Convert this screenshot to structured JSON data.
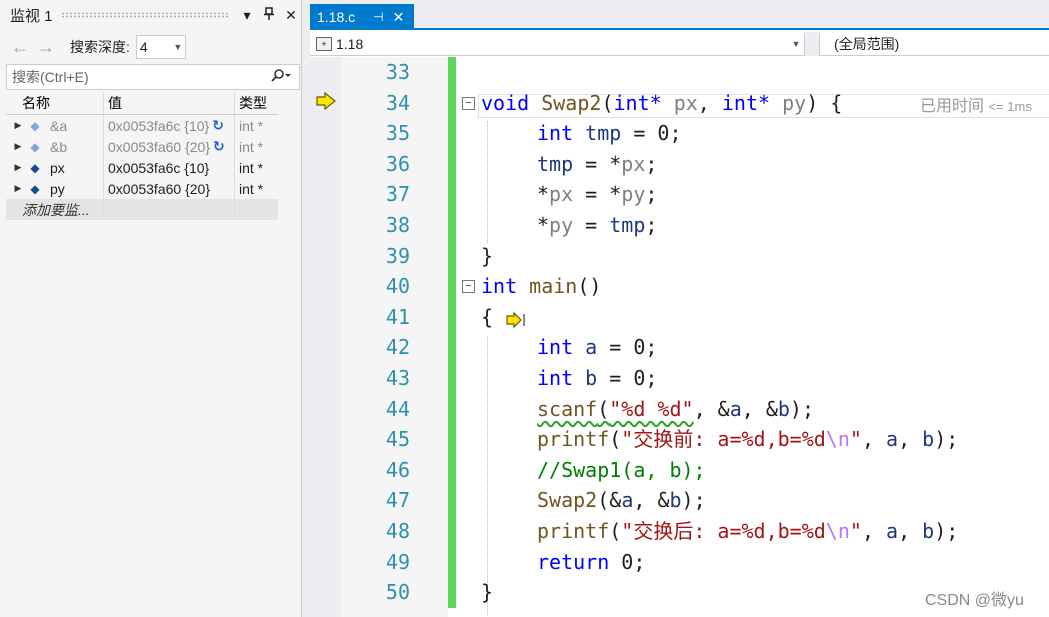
{
  "watch": {
    "title": "监视 1",
    "pin_icon": "pin-icon",
    "close_icon": "close-icon",
    "menu_icon": "dropdown-icon",
    "depth_label": "搜索深度:",
    "depth_value": "4",
    "search_placeholder": "搜索(Ctrl+E)",
    "columns": [
      "名称",
      "值",
      "类型"
    ],
    "rows": [
      {
        "name": "&a",
        "value": "0x0053fa6c {10}",
        "type": "int *",
        "stale": true
      },
      {
        "name": "&b",
        "value": "0x0053fa60 {20}",
        "type": "int *",
        "stale": true
      },
      {
        "name": "px",
        "value": "0x0053fa6c {10}",
        "type": "int *",
        "stale": false
      },
      {
        "name": "py",
        "value": "0x0053fa60 {20}",
        "type": "int *",
        "stale": false
      }
    ],
    "add_row_label": "添加要监..."
  },
  "editor": {
    "tab_label": "1.18.c",
    "nav_project": "1.18",
    "nav_scope": "(全局范围)",
    "hint_text": "已用时间",
    "hint_small": "<= 1ms",
    "line_numbers": [
      "33",
      "34",
      "35",
      "36",
      "37",
      "38",
      "39",
      "40",
      "41",
      "42",
      "43",
      "44",
      "45",
      "46",
      "47",
      "48",
      "49",
      "50"
    ],
    "code": {
      "l34": {
        "kw1": "void",
        "fn": "Swap2",
        "p1": "(",
        "kw2": "int*",
        "px": "px",
        "c": ", ",
        "kw3": "int*",
        "py": "py",
        "end": ") {"
      },
      "l35": {
        "kw": "int",
        "var": "tmp",
        "rest": " = 0;"
      },
      "l36": {
        "a": "tmp",
        "b": " = *",
        "c": "px",
        "d": ";"
      },
      "l37": {
        "a": "*",
        "b": "px",
        "c": " = *",
        "d": "py",
        "e": ";"
      },
      "l38": {
        "a": "*",
        "b": "py",
        "c": " = ",
        "d": "tmp",
        "e": ";"
      },
      "l39": "}",
      "l40": {
        "kw": "int",
        "fn": "main",
        "rest": "()"
      },
      "l41": "{",
      "l42": {
        "kw": "int",
        "var": "a",
        "rest": " = 0;"
      },
      "l43": {
        "kw": "int",
        "var": "b",
        "rest": " = 0;"
      },
      "l44": {
        "fn": "scanf",
        "p": "(",
        "str": "\"%d %d\"",
        "rest1": ", &",
        "a": "a",
        "rest2": ", &",
        "b": "b",
        "end": ");"
      },
      "l45": {
        "fn": "printf",
        "p": "(",
        "str": "\"交换前: a=%d,b=%d",
        "esc": "\\n",
        "q": "\"",
        "rest1": ", ",
        "a": "a",
        "rest2": ", ",
        "b": "b",
        "end": ");"
      },
      "l46": "//Swap1(a, b);",
      "l47": {
        "fn": "Swap2",
        "p": "(&",
        "a": "a",
        "c": ", &",
        "b": "b",
        "end": ");"
      },
      "l48": {
        "fn": "printf",
        "p": "(",
        "str": "\"交换后: a=%d,b=%d",
        "esc": "\\n",
        "q": "\"",
        "rest1": ", ",
        "a": "a",
        "rest2": ", ",
        "b": "b",
        "end": ");"
      },
      "l49": {
        "kw": "return",
        "rest": " 0;"
      },
      "l50": "}"
    }
  },
  "watermark": "CSDN @微yu",
  "colors": {
    "accent": "#007acc",
    "keyword": "#0000ff",
    "string": "#a31515",
    "comment": "#008000",
    "line_number": "#2b91af",
    "change_bar": "#5cd65c"
  }
}
